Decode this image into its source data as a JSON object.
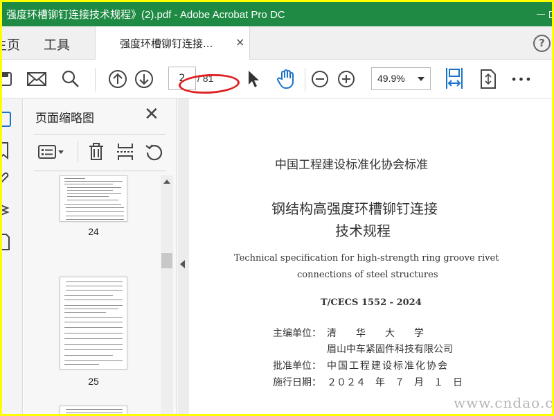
{
  "window": {
    "title": "强度环槽铆钉连接技术规程》(2).pdf - Adobe Acrobat Pro DC",
    "colors": {
      "titlebar": "#1e8a43",
      "accent_blue": "#1a73c8",
      "annotation_red": "#e02020",
      "highlight_border": "#ffff00"
    }
  },
  "nav": {
    "home_label": "主页",
    "tools_label": "工具"
  },
  "tab": {
    "label": "强度环槽铆钉连接...",
    "close": "×"
  },
  "help": {
    "label": "?"
  },
  "toolbar": {
    "page_current": "2",
    "page_total": "/ 81",
    "zoom": "49.9%",
    "more": "•••"
  },
  "thumbnails": {
    "title": "页面缩略图",
    "close": "✕",
    "pages": [
      {
        "label": "24"
      },
      {
        "label": "25"
      }
    ]
  },
  "document": {
    "org_standard": "中国工程建设标准化协会标准",
    "title_line1": "钢结构高强度环槽铆钉连接",
    "title_line2": "技术规程",
    "english_line1": "Technical specification for high-strength ring groove rivet",
    "english_line2": "connections of steel structures",
    "code": "T/CECS 1552 - 2024",
    "chief_label": "主编单位：",
    "chief_value1": "清　　华　　大　　学",
    "chief_value2": "眉山中车紧固件科技有限公司",
    "approve_label": "批准单位：",
    "approve_value": "中国工程建设标准化协会",
    "effective_label": "施行日期：",
    "effective_value": "２０２４　年　７　月　１　日"
  },
  "watermark": "www.cndao.com",
  "icons": [
    "save-icon",
    "mail-icon",
    "search-icon",
    "page-up-icon",
    "page-down-icon",
    "select-cursor-icon",
    "hand-tool-icon",
    "zoom-out-icon",
    "zoom-in-icon",
    "fit-width-icon",
    "full-screen-icon",
    "more-icon",
    "thumbnail-options-icon",
    "delete-icon",
    "extract-icon",
    "rotate-icon"
  ]
}
